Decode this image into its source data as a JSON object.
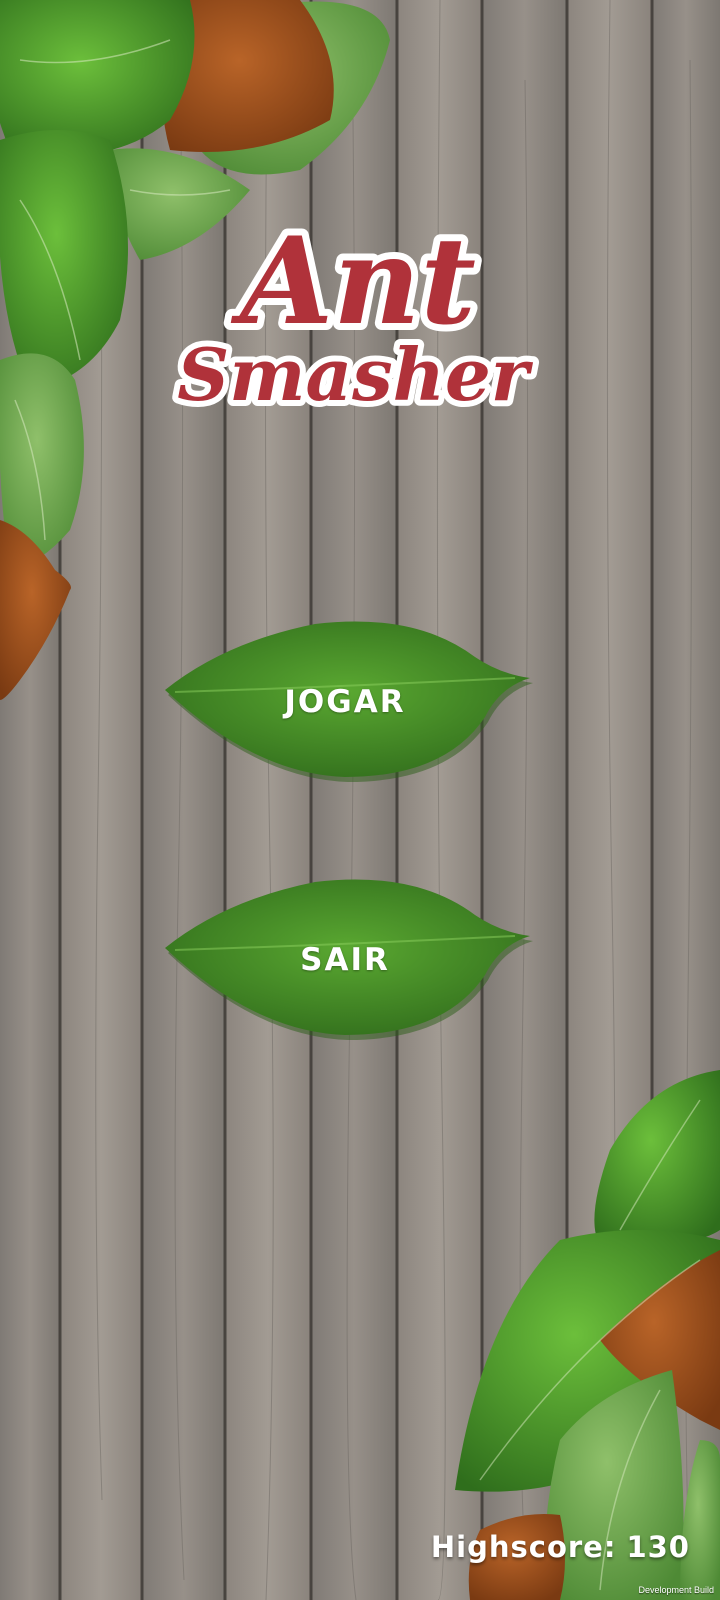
{
  "game": {
    "logo_line1": "Ant",
    "logo_line2": "Smasher"
  },
  "menu": {
    "play_label": "JOGAR",
    "exit_label": "SAIR"
  },
  "hud": {
    "highscore_label": "Highscore:",
    "highscore_value": "130",
    "build_label": "Development Build"
  },
  "colors": {
    "leaf_green": "#4e9a2a",
    "leaf_dark": "#2f6b1a",
    "leaf_brown": "#9c4e1c",
    "logo_red": "#b0323a",
    "wood": "#8d8782"
  }
}
